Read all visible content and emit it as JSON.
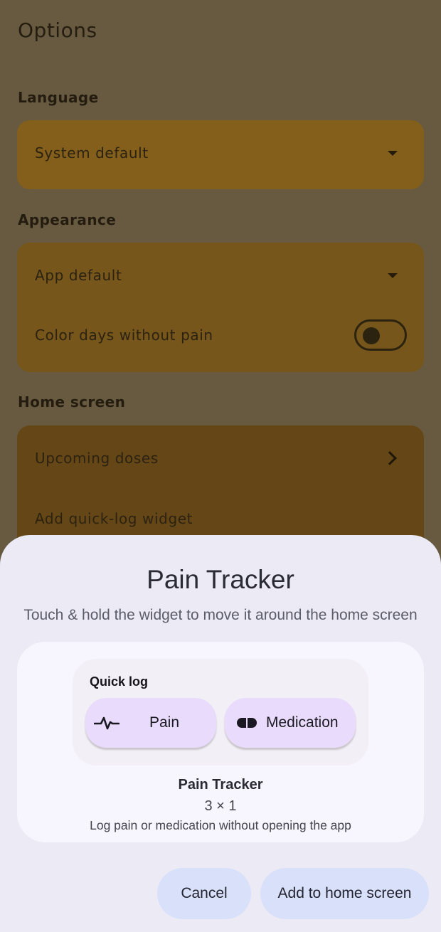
{
  "background": {
    "title": "Options",
    "language": {
      "label": "Language",
      "value": "System default"
    },
    "appearance": {
      "label": "Appearance",
      "theme_value": "App default",
      "color_days_label": "Color days without pain"
    },
    "home_screen": {
      "label": "Home screen",
      "upcoming_doses": "Upcoming doses",
      "add_widget": "Add quick-log widget"
    },
    "colors": {
      "scrim": "#675a40",
      "card": "#825f1a",
      "card2": "#654616"
    }
  },
  "sheet": {
    "title": "Pain Tracker",
    "subtitle": "Touch & hold the widget to move it around the home screen",
    "widget": {
      "label": "Quick log",
      "pain_button": "Pain",
      "medication_button": "Medication"
    },
    "preview_name": "Pain Tracker",
    "preview_size": "3 × 1",
    "preview_description": "Log pain or medication without opening the app",
    "cancel_label": "Cancel",
    "add_label": "Add to home screen"
  },
  "icons": [
    "caret-down-icon",
    "chevron-right-icon",
    "pulse-icon",
    "pill-icon"
  ]
}
